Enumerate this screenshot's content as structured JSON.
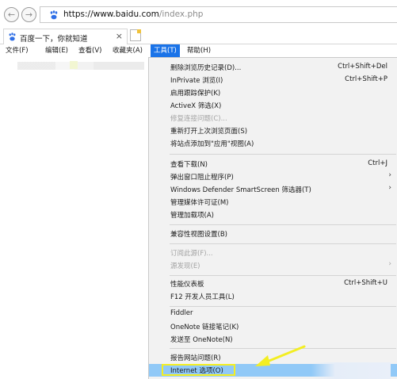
{
  "address_bar": {
    "url_host": "https://www.baidu.com",
    "url_path": "/index.php",
    "back_icon": "arrow-left-icon",
    "forward_icon": "arrow-right-icon",
    "site_icon": "baidu-paw-icon"
  },
  "tab": {
    "title": "百度一下，你就知道",
    "close": "×"
  },
  "menu_bar": {
    "file": "文件(F)",
    "edit": "编辑(E)",
    "view": "查看(V)",
    "favorites": "收藏夹(A)",
    "tools": "工具(T)",
    "help": "帮助(H)"
  },
  "tools_menu": {
    "items": [
      {
        "label": "删除浏览历史记录(D)...",
        "shortcut": "Ctrl+Shift+Del"
      },
      {
        "label": "InPrivate 浏览(I)",
        "shortcut": "Ctrl+Shift+P"
      },
      {
        "label": "启用跟踪保护(K)",
        "shortcut": ""
      },
      {
        "label": "ActiveX 筛选(X)",
        "shortcut": ""
      },
      {
        "label": "修复连接问题(C)...",
        "shortcut": "",
        "disabled": true
      },
      {
        "label": "重新打开上次浏览页面(S)",
        "shortcut": ""
      },
      {
        "label": "将站点添加到\"应用\"视图(A)",
        "shortcut": ""
      },
      {
        "label": "查看下载(N)",
        "shortcut": "Ctrl+J"
      },
      {
        "label": "弹出窗口阻止程序(P)",
        "shortcut": ""
      },
      {
        "label": "Windows Defender SmartScreen 筛选器(T)",
        "shortcut": ""
      },
      {
        "label": "管理媒体许可证(M)",
        "shortcut": ""
      },
      {
        "label": "管理加载项(A)",
        "shortcut": ""
      },
      {
        "label": "兼容性视图设置(B)",
        "shortcut": ""
      },
      {
        "label": "订阅此源(F)...",
        "shortcut": "",
        "disabled": true
      },
      {
        "label": "源发现(E)",
        "shortcut": "",
        "disabled": true
      },
      {
        "label": "性能仪表板",
        "shortcut": "Ctrl+Shift+U"
      },
      {
        "label": "F12 开发人员工具(L)",
        "shortcut": ""
      },
      {
        "label": "Fiddler",
        "shortcut": ""
      },
      {
        "label": "OneNote 链接笔记(K)",
        "shortcut": ""
      },
      {
        "label": "发送至 OneNote(N)",
        "shortcut": ""
      },
      {
        "label": "报告网站问题(R)",
        "shortcut": ""
      },
      {
        "label": "Internet 选项(O)",
        "shortcut": ""
      }
    ],
    "submenu_arrow": "›"
  },
  "colors": {
    "menu_active": "#1a73e8",
    "highlight_row": "#91c9f7",
    "annotation": "#f3ee22"
  }
}
